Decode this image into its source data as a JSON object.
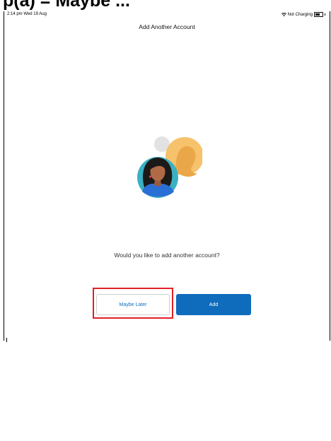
{
  "caption": {
    "text": "p(a) = Maybe ..."
  },
  "status_bar": {
    "time": "2:14 pm  Wed 19 Aug",
    "network": "Not Charging"
  },
  "nav": {
    "title": "Add Another Account"
  },
  "prompt": {
    "question": "Would you like to add another account?"
  },
  "buttons": {
    "maybe_later": "Maybe Later",
    "add": "Add"
  },
  "colors": {
    "accent": "#0f6cbd",
    "highlight": "#e0202a"
  },
  "icons": {
    "wifi": "wifi-icon",
    "battery": "battery-icon",
    "illustration": "accounts-illustration"
  }
}
